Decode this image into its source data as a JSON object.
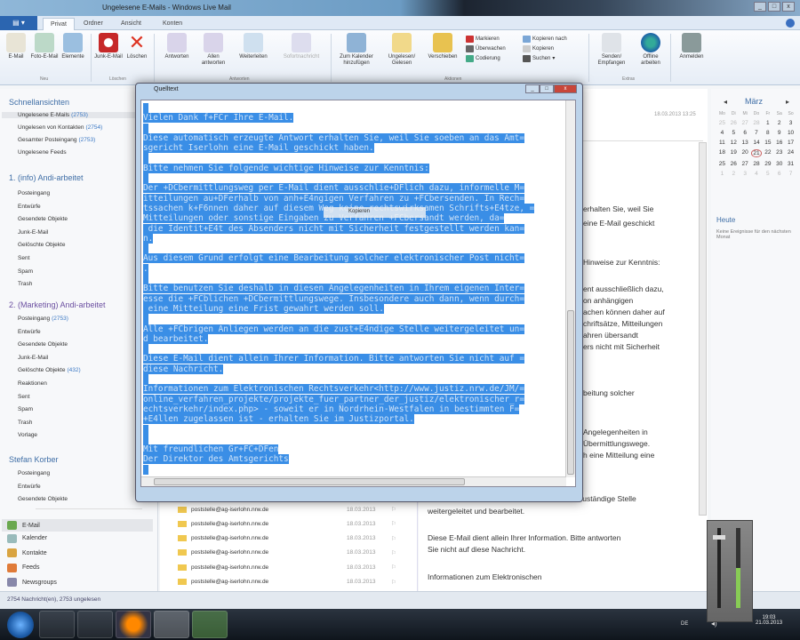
{
  "window": {
    "title": "Ungelesene E-Mails - Windows Live Mail"
  },
  "tabs": [
    "Privat",
    "Ordner",
    "Ansicht",
    "Konten"
  ],
  "ribbon": {
    "groups": [
      "Neu",
      "Löschen",
      "Antworten",
      "Aktionen",
      "Extras"
    ],
    "buttons": [
      "E-Mail",
      "Foto-E-Mail",
      "Elemente",
      "Junk-E-Mail",
      "Löschen",
      "Antworten",
      "Allen antworten",
      "Weiterleiten",
      "Sofortnachricht",
      "Zum Kalender hinzufügen",
      "Ungelesen/ Gelesen",
      "Verschieben",
      "Senden/ Empfangen",
      "Offline arbeiten",
      "Anmelden"
    ],
    "small": [
      "Markieren",
      "Überwachen",
      "Codierung",
      "Kopieren nach",
      "Kopieren",
      "Suchen"
    ]
  },
  "sidebar": {
    "quick_title": "Schnellansichten",
    "quick": [
      {
        "label": "Ungelesene E-Mails",
        "count": "(2753)"
      },
      {
        "label": "Ungelesen von Kontakten",
        "count": "(2754)"
      },
      {
        "label": "Gesamter Posteingang",
        "count": "(2753)"
      },
      {
        "label": "Ungelesene Feeds",
        "count": ""
      }
    ],
    "acc1": "1. (info) Andi-arbeitet",
    "acc1_folders": [
      "Posteingang",
      "Entwürfe",
      "Gesendete Objekte",
      "Junk-E-Mail",
      "Gelöschte Objekte",
      "Sent",
      "Spam",
      "Trash"
    ],
    "acc2": "2. (Marketing) Andi-arbeitet",
    "acc2_folders": [
      {
        "label": "Posteingang",
        "count": "(2753)"
      },
      {
        "label": "Entwürfe",
        "count": ""
      },
      {
        "label": "Gesendete Objekte",
        "count": ""
      },
      {
        "label": "Junk-E-Mail",
        "count": ""
      },
      {
        "label": "Gelöschte Objekte",
        "count": "(432)"
      },
      {
        "label": "Reaktionen",
        "count": ""
      },
      {
        "label": "Sent",
        "count": ""
      },
      {
        "label": "Spam",
        "count": ""
      },
      {
        "label": "Trash",
        "count": ""
      },
      {
        "label": "Vorlage",
        "count": ""
      }
    ],
    "acc3": "Stefan Korber",
    "acc3_folders": [
      "Posteingang",
      "Entwürfe",
      "Gesendete Objekte"
    ],
    "nav": [
      "E-Mail",
      "Kalender",
      "Kontakte",
      "Feeds",
      "Newsgroups"
    ]
  },
  "messages": [
    {
      "from": "poststelle@ag-iserlohn.nrw.de",
      "date": "18.03.2013"
    },
    {
      "from": "poststelle@ag-iserlohn.nrw.de",
      "date": "18.03.2013"
    },
    {
      "from": "poststelle@ag-iserlohn.nrw.de",
      "date": "18.03.2013"
    },
    {
      "from": "poststelle@ag-iserlohn.nrw.de",
      "date": "18.03.2013"
    },
    {
      "from": "poststelle@ag-iserlohn.nrw.de",
      "date": "18.03.2013"
    },
    {
      "from": "poststelle@ag-iserlohn.nrw.de",
      "date": "18.03.2013"
    },
    {
      "from": "poststelle@ag-iserlohn.nrw.de",
      "date": "18.03.2013"
    }
  ],
  "reading": {
    "date": "18.03.2013 13:25",
    "fragments": [
      "erhalten Sie, weil Sie",
      "eine E-Mail geschickt",
      "Hinweise zur Kenntnis:",
      "ent ausschließlich dazu,",
      "on anhängigen",
      "achen können daher auf",
      "chriftsätze, Mitteilungen",
      "ahren übersandt",
      "ers nicht mit Sicherheit",
      "beitung solcher",
      "Angelegenheiten in",
      "Übermittlungswege.",
      "h eine Mitteilung eine",
      "zuständige Stelle"
    ],
    "lower": [
      "weitergeleitet und bearbeitet.",
      "Diese E-Mail dient allein Ihrer Information. Bitte antworten",
      "Sie nicht auf diese Nachricht.",
      "Informationen zum Elektronischen"
    ]
  },
  "calendar": {
    "month": "März",
    "prev": "◂",
    "next": "▸",
    "weekdays": [
      "Mo",
      "Di",
      "Mi",
      "Do",
      "Fr",
      "Sa",
      "So"
    ],
    "days": [
      "25",
      "26",
      "27",
      "28",
      "1",
      "2",
      "3",
      "4",
      "5",
      "6",
      "7",
      "8",
      "9",
      "10",
      "11",
      "12",
      "13",
      "14",
      "15",
      "16",
      "17",
      "18",
      "19",
      "20",
      "21",
      "22",
      "23",
      "24",
      "25",
      "26",
      "27",
      "28",
      "29",
      "30",
      "31",
      "1",
      "2",
      "3",
      "4",
      "5",
      "6",
      "7"
    ],
    "today": "21",
    "heute": "Heute",
    "no_events": "Keine Ereignisse für den nächsten Monat"
  },
  "status": "2754 Nachricht(en), 2753 ungelesen",
  "dialog": {
    "title": "Quelltext",
    "context_menu": "Kopieren",
    "lines": [
      "",
      "Vielen Dank f+FCr Ihre E-Mail.",
      "",
      "Diese automatisch erzeugte Antwort erhalten Sie, weil Sie soeben an das Amt=",
      "sgericht Iserlohn eine E-Mail geschickt haben.",
      "",
      "Bitte nehmen Sie folgende wichtige Hinweise zur Kenntnis:",
      "",
      "Der +DCbermittlungsweg per E-Mail dient ausschlie+DFlich dazu, informelle M=",
      "itteilungen au+DFerhalb von anh+E4ngigen Verfahren zu +FCbersenden. In Rech=",
      "tssachen k+F6nnen daher auf diesem Weg keine rechtswirksamen Schrifts+E4tze, =",
      "Mitteilungen oder sonstige Eingaben zu Verfahren +FCbersandt werden, da=",
      " die Identit+E4t des Absenders nicht mit Sicherheit festgestellt werden kan=",
      "n.",
      "",
      "Aus diesem Grund erfolgt eine Bearbeitung solcher elektronischer Post nicht=",
      ".",
      "",
      "Bitte benutzen Sie deshalb in diesen Angelegenheiten in Ihrem eigenen Inter=",
      "esse die +FCblichen +DCbermittlungswege. Insbesondere auch dann, wenn durch=",
      " eine Mitteilung eine Frist gewahrt werden soll.",
      "",
      "Alle +FCbrigen Anliegen werden an die zust+E4ndige Stelle weitergeleitet un=",
      "d bearbeitet.",
      "",
      "Diese E-Mail dient allein Ihrer Information. Bitte antworten Sie nicht auf =",
      "diese Nachricht.",
      "",
      "Informationen zum Elektronischen Rechtsverkehr<http://www.justiz.nrw.de/JM/=",
      "online_verfahren_projekte/projekte_fuer_partner_der_justiz/elektronischer_r=",
      "echtsverkehr/index.php> - soweit er in Nordrhein-Westfalen in bestimmten F=",
      "+E4llen zugelassen ist - erhalten Sie im Justizportal.",
      "",
      "",
      "Mit freundlichen Gr+FC+DFen",
      "Der Direktor des Amtsgerichts",
      ""
    ]
  },
  "taskbar": {
    "lang": "DE",
    "time": "19:03",
    "date": "21.03.2013"
  },
  "colors": {
    "selection": "#3a8ee6",
    "accent": "#2b65b0"
  }
}
